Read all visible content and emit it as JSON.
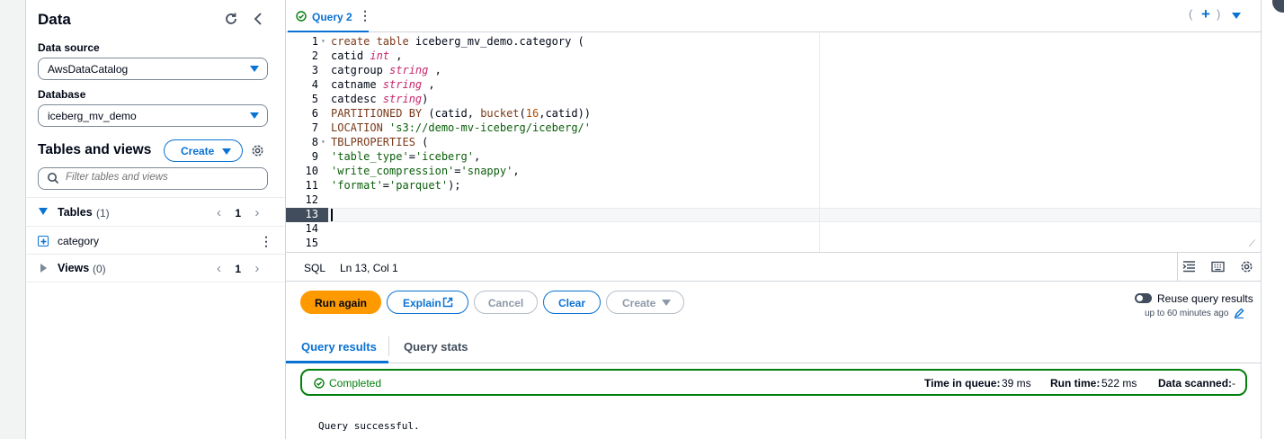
{
  "sidebar": {
    "title": "Data",
    "data_source_label": "Data source",
    "data_source_value": "AwsDataCatalog",
    "database_label": "Database",
    "database_value": "iceberg_mv_demo",
    "tables_views_title": "Tables and views",
    "create_label": "Create",
    "filter_placeholder": "Filter tables and views",
    "tables": {
      "label": "Tables",
      "count": "(1)",
      "page": "1"
    },
    "table_items": [
      "category"
    ],
    "views": {
      "label": "Views",
      "count": "(0)",
      "page": "1"
    }
  },
  "editor": {
    "tab_label": "Query 2",
    "line_numbers": [
      "1",
      "2",
      "3",
      "4",
      "5",
      "6",
      "7",
      "8",
      "9",
      "10",
      "11",
      "12",
      "13",
      "14",
      "15"
    ],
    "language": "SQL",
    "cursor": "Ln 13, Col 1"
  },
  "actions": {
    "run_again": "Run again",
    "explain": "Explain",
    "cancel": "Cancel",
    "clear": "Clear",
    "create": "Create",
    "reuse_label": "Reuse query results",
    "reuse_sub": "up to 60 minutes ago"
  },
  "results": {
    "tab_results": "Query results",
    "tab_stats": "Query stats",
    "status": "Completed",
    "time_in_queue_label": "Time in queue:",
    "time_in_queue": "39 ms",
    "run_time_label": "Run time:",
    "run_time": "522 ms",
    "data_scanned_label": "Data scanned:",
    "data_scanned": "-",
    "message": "Query successful."
  },
  "colors": {
    "accent": "#0972d3",
    "primary_button": "#ff9900",
    "success": "#037f0c"
  }
}
